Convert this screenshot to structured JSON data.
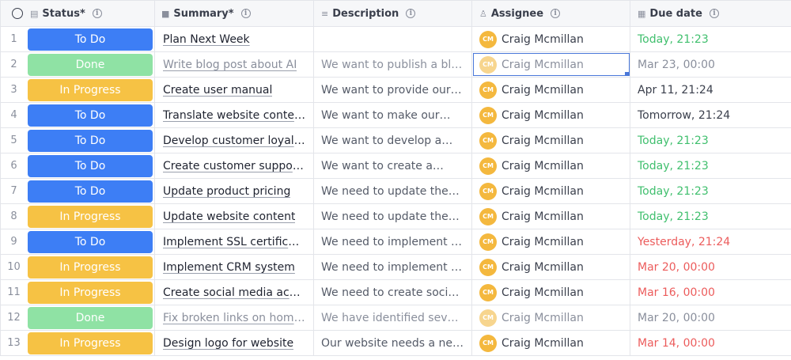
{
  "columns": [
    {
      "key": "status",
      "label": "Status*",
      "icon": "clipboard-icon"
    },
    {
      "key": "summary",
      "label": "Summary*",
      "icon": "text-block-icon"
    },
    {
      "key": "description",
      "label": "Description",
      "icon": "align-left-icon"
    },
    {
      "key": "assignee",
      "label": "Assignee",
      "icon": "user-icon"
    },
    {
      "key": "due",
      "label": "Due date",
      "icon": "calendar-icon"
    }
  ],
  "status_colors": {
    "To Do": "#3d7ef5",
    "Done": "#8fe2a4",
    "In Progress": "#f6c244"
  },
  "due_colors": {
    "green": "#3fbf6d",
    "red": "#ec5c5c",
    "gray": "#8a8f9c",
    "dark": "#3a3f4c"
  },
  "rows": [
    {
      "num": "1",
      "status": "To Do",
      "summary": "Plan Next Week",
      "description": "",
      "assignee_initials": "CM",
      "assignee": "Craig Mcmillan",
      "due": "Today, 21:23",
      "due_tone": "green"
    },
    {
      "num": "2",
      "status": "Done",
      "summary": "Write blog post about AI",
      "description": "We want to publish a blog…",
      "assignee_initials": "CM",
      "assignee": "Craig Mcmillan",
      "due": "Mar 23, 00:00",
      "due_tone": "gray"
    },
    {
      "num": "3",
      "status": "In Progress",
      "summary": "Create user manual",
      "description": "We want to provide our…",
      "assignee_initials": "CM",
      "assignee": "Craig Mcmillan",
      "due": "Apr 11, 21:24",
      "due_tone": "dark"
    },
    {
      "num": "4",
      "status": "To Do",
      "summary": "Translate website content",
      "description": "We want to make our…",
      "assignee_initials": "CM",
      "assignee": "Craig Mcmillan",
      "due": "Tomorrow, 21:24",
      "due_tone": "dark"
    },
    {
      "num": "5",
      "status": "To Do",
      "summary": "Develop customer loyalty …",
      "description": "We want to develop a…",
      "assignee_initials": "CM",
      "assignee": "Craig Mcmillan",
      "due": "Today, 21:23",
      "due_tone": "green"
    },
    {
      "num": "6",
      "status": "To Do",
      "summary": "Create customer support …",
      "description": "We want to create a…",
      "assignee_initials": "CM",
      "assignee": "Craig Mcmillan",
      "due": "Today, 21:23",
      "due_tone": "green"
    },
    {
      "num": "7",
      "status": "To Do",
      "summary": "Update product pricing",
      "description": "We need to update the…",
      "assignee_initials": "CM",
      "assignee": "Craig Mcmillan",
      "due": "Today, 21:23",
      "due_tone": "green"
    },
    {
      "num": "8",
      "status": "In Progress",
      "summary": "Update website content",
      "description": "We need to update the…",
      "assignee_initials": "CM",
      "assignee": "Craig Mcmillan",
      "due": "Today, 21:23",
      "due_tone": "green"
    },
    {
      "num": "9",
      "status": "To Do",
      "summary": "Implement SSL certificate",
      "description": "We need to implement an…",
      "assignee_initials": "CM",
      "assignee": "Craig Mcmillan",
      "due": "Yesterday, 21:24",
      "due_tone": "red"
    },
    {
      "num": "10",
      "status": "In Progress",
      "summary": "Implement CRM system",
      "description": "We need to implement a…",
      "assignee_initials": "CM",
      "assignee": "Craig Mcmillan",
      "due": "Mar 20, 00:00",
      "due_tone": "red"
    },
    {
      "num": "11",
      "status": "In Progress",
      "summary": "Create social media accou…",
      "description": "We need to create social…",
      "assignee_initials": "CM",
      "assignee": "Craig Mcmillan",
      "due": "Mar 16, 00:00",
      "due_tone": "red"
    },
    {
      "num": "12",
      "status": "Done",
      "summary": "Fix broken links on homep…",
      "description": "We have identified several…",
      "assignee_initials": "CM",
      "assignee": "Craig Mcmillan",
      "due": "Mar 20, 00:00",
      "due_tone": "gray"
    },
    {
      "num": "13",
      "status": "In Progress",
      "summary": "Design logo for website",
      "description": "Our website needs a new…",
      "assignee_initials": "CM",
      "assignee": "Craig Mcmillan",
      "due": "Mar 14, 00:00",
      "due_tone": "red"
    }
  ]
}
